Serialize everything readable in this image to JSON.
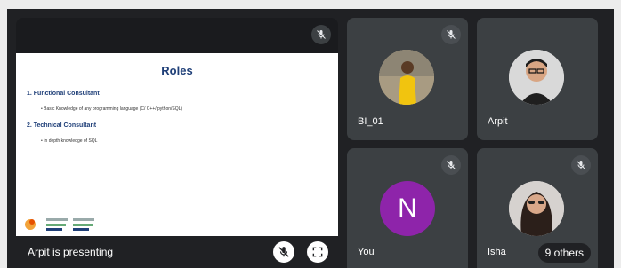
{
  "presentation": {
    "presenter_label": "Arpit is presenting",
    "slide": {
      "title": "Roles",
      "items": [
        {
          "label": "1.  Functional Consultant",
          "sub": "•  Basic Knowledge of any programming language (C/ C++/ python/SQL)"
        },
        {
          "label": "2.  Technical Consultant",
          "sub": "•  In depth knowledge of SQL"
        }
      ]
    }
  },
  "participants": [
    {
      "name": "BI_01",
      "muted": true,
      "avatar_kind": "photo"
    },
    {
      "name": "Arpit",
      "muted": false,
      "avatar_kind": "photo"
    },
    {
      "name": "You",
      "muted": true,
      "avatar_kind": "initial",
      "initial": "N",
      "avatar_color": "#8e24aa"
    },
    {
      "name": "Isha",
      "muted": true,
      "avatar_kind": "photo"
    }
  ],
  "others_label": "9 others",
  "icons": {
    "mic_off": "mic-off-icon",
    "fullscreen": "fullscreen-icon"
  },
  "colors": {
    "background": "#202124",
    "tile": "#3c4043",
    "slide_heading": "#1f3f78"
  }
}
